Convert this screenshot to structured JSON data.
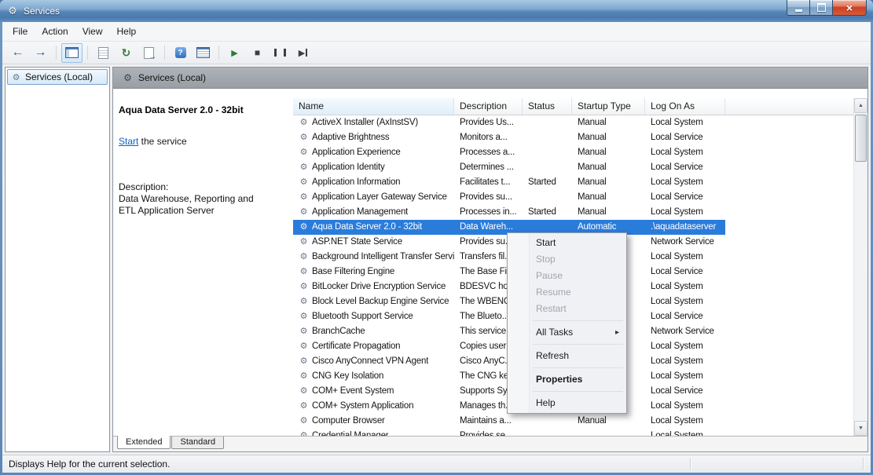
{
  "window": {
    "title": "Services"
  },
  "icons": {
    "gear": "⚙",
    "submenu_arrow": "▸",
    "scroll_up": "▲",
    "scroll_down": "▼",
    "close_glyph": "×"
  },
  "menubar": {
    "items": [
      "File",
      "Action",
      "View",
      "Help"
    ]
  },
  "toolbar": {
    "buttons": [
      {
        "name": "back"
      },
      {
        "name": "forward"
      },
      {
        "type": "separator"
      },
      {
        "name": "show-console-tree",
        "pressed": true
      },
      {
        "type": "separator"
      },
      {
        "name": "properties"
      },
      {
        "name": "refresh"
      },
      {
        "name": "export-list"
      },
      {
        "type": "separator"
      },
      {
        "name": "help"
      },
      {
        "name": "view-list"
      },
      {
        "type": "separator"
      },
      {
        "name": "start-service"
      },
      {
        "name": "stop-service"
      },
      {
        "name": "pause-service"
      },
      {
        "name": "restart-service"
      }
    ]
  },
  "tree": {
    "root_label": "Services (Local)"
  },
  "content_header": {
    "title": "Services (Local)"
  },
  "detail": {
    "service_name": "Aqua Data Server 2.0 - 32bit",
    "start_link": "Start",
    "start_suffix": " the service",
    "description_label": "Description:",
    "description": "Data Warehouse, Reporting and ETL Application Server"
  },
  "table": {
    "columns": [
      "Name",
      "Description",
      "Status",
      "Startup Type",
      "Log On As"
    ],
    "selected_index": 7,
    "rows": [
      {
        "name": "ActiveX Installer (AxInstSV)",
        "description": "Provides Us...",
        "status": "",
        "startup": "Manual",
        "logon": "Local System"
      },
      {
        "name": "Adaptive Brightness",
        "description": "Monitors a...",
        "status": "",
        "startup": "Manual",
        "logon": "Local Service"
      },
      {
        "name": "Application Experience",
        "description": "Processes a...",
        "status": "",
        "startup": "Manual",
        "logon": "Local System"
      },
      {
        "name": "Application Identity",
        "description": "Determines ...",
        "status": "",
        "startup": "Manual",
        "logon": "Local Service"
      },
      {
        "name": "Application Information",
        "description": "Facilitates t...",
        "status": "Started",
        "startup": "Manual",
        "logon": "Local System"
      },
      {
        "name": "Application Layer Gateway Service",
        "description": "Provides su...",
        "status": "",
        "startup": "Manual",
        "logon": "Local Service"
      },
      {
        "name": "Application Management",
        "description": "Processes in...",
        "status": "Started",
        "startup": "Manual",
        "logon": "Local System"
      },
      {
        "name": "Aqua Data Server 2.0 - 32bit",
        "description": "Data Wareh...",
        "status": "",
        "startup": "Automatic",
        "logon": ".\\aquadataserver"
      },
      {
        "name": "ASP.NET State Service",
        "description": "Provides su...",
        "status": "",
        "startup": "",
        "logon": "Network Service"
      },
      {
        "name": "Background Intelligent Transfer Service",
        "description": "Transfers fil...",
        "status": "",
        "startup": "",
        "logon": "Local System"
      },
      {
        "name": "Base Filtering Engine",
        "description": "The Base Fil...",
        "status": "",
        "startup": "",
        "logon": "Local Service"
      },
      {
        "name": "BitLocker Drive Encryption Service",
        "description": "BDESVC hos...",
        "status": "",
        "startup": "",
        "logon": "Local System"
      },
      {
        "name": "Block Level Backup Engine Service",
        "description": "The WBENG...",
        "status": "",
        "startup": "",
        "logon": "Local System"
      },
      {
        "name": "Bluetooth Support Service",
        "description": "The Blueto...",
        "status": "",
        "startup": "",
        "logon": "Local Service"
      },
      {
        "name": "BranchCache",
        "description": "This service ...",
        "status": "",
        "startup": "",
        "logon": "Network Service"
      },
      {
        "name": "Certificate Propagation",
        "description": "Copies user ...",
        "status": "",
        "startup": "",
        "logon": "Local System"
      },
      {
        "name": "Cisco AnyConnect VPN Agent",
        "description": "Cisco AnyC...",
        "status": "",
        "startup": "",
        "logon": "Local System"
      },
      {
        "name": "CNG Key Isolation",
        "description": "The CNG ke...",
        "status": "",
        "startup": "",
        "logon": "Local System"
      },
      {
        "name": "COM+ Event System",
        "description": "Supports Sy...",
        "status": "",
        "startup": "",
        "logon": "Local Service"
      },
      {
        "name": "COM+ System Application",
        "description": "Manages th...",
        "status": "",
        "startup": "",
        "logon": "Local System"
      },
      {
        "name": "Computer Browser",
        "description": "Maintains a...",
        "status": "",
        "startup": "Manual",
        "logon": "Local System"
      },
      {
        "name": "Credential Manager",
        "description": "Provides se...",
        "status": "",
        "startup": "",
        "logon": "Local System"
      }
    ]
  },
  "context_menu": {
    "items": [
      {
        "type": "item",
        "label": "Start",
        "enabled": true
      },
      {
        "type": "item",
        "label": "Stop",
        "enabled": false
      },
      {
        "type": "item",
        "label": "Pause",
        "enabled": false
      },
      {
        "type": "item",
        "label": "Resume",
        "enabled": false
      },
      {
        "type": "item",
        "label": "Restart",
        "enabled": false
      },
      {
        "type": "separator"
      },
      {
        "type": "item",
        "label": "All Tasks",
        "enabled": true,
        "submenu": true
      },
      {
        "type": "separator"
      },
      {
        "type": "item",
        "label": "Refresh",
        "enabled": true
      },
      {
        "type": "separator"
      },
      {
        "type": "item",
        "label": "Properties",
        "enabled": true,
        "bold": true
      },
      {
        "type": "separator"
      },
      {
        "type": "item",
        "label": "Help",
        "enabled": true
      }
    ]
  },
  "tabs": [
    {
      "label": "Extended",
      "active": true
    },
    {
      "label": "Standard",
      "active": false
    }
  ],
  "statusbar": {
    "text": "Displays Help for the current selection."
  },
  "colors": {
    "selection_bg": "#2a7cdb",
    "selection_text": "#ffffff",
    "link": "#0d5fc0",
    "titlebar_blue": "#5583b4",
    "close_button_red": "#cc4024"
  }
}
